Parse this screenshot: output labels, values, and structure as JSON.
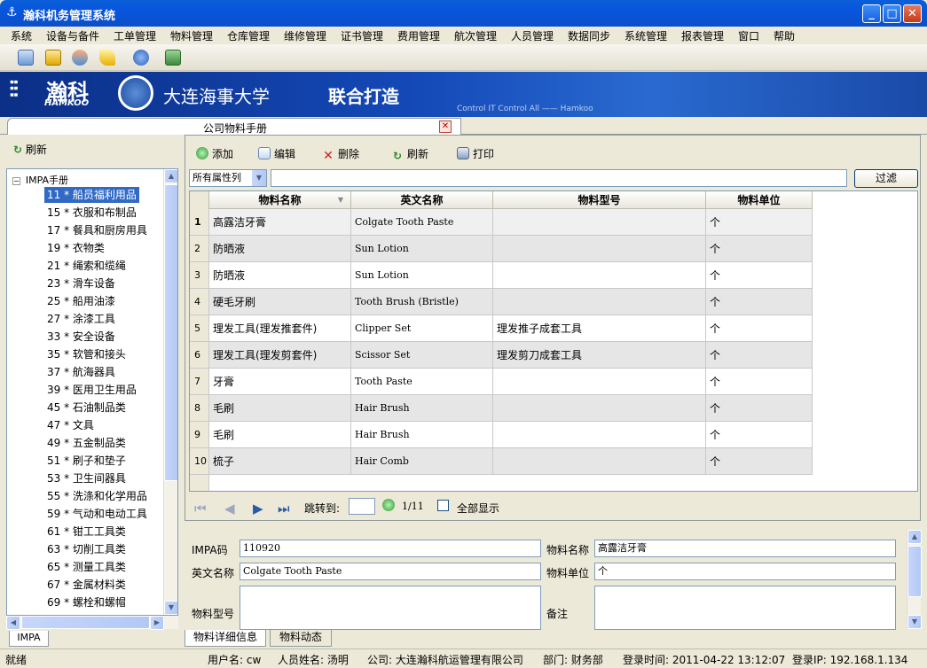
{
  "window": {
    "title": "瀚科机务管理系统",
    "btn_min": "_",
    "btn_max": "□",
    "btn_close": "✕"
  },
  "menu": [
    "系统",
    "设备与备件",
    "工单管理",
    "物料管理",
    "仓库管理",
    "维修管理",
    "证书管理",
    "费用管理",
    "航次管理",
    "人员管理",
    "数据同步",
    "系统管理",
    "报表管理",
    "窗口",
    "帮助"
  ],
  "banner": {
    "logo_cn": "瀚科",
    "logo_en": "HAMKOO",
    "university": "大连海事大学",
    "slogan": "联合打造",
    "tagline": "Control IT Control All —— Hamkoo"
  },
  "doc_tab": {
    "title": "公司物料手册",
    "close": "✕"
  },
  "left": {
    "refresh": "刷新",
    "tree_root": "IMPA手册",
    "tree_items": [
      "11 * 船员福利用品",
      "15 * 衣服和布制品",
      "17 * 餐具和厨房用具",
      "19 * 衣物类",
      "21 * 绳索和缆绳",
      "23 * 滑车设备",
      "25 * 船用油漆",
      "27 * 涂漆工具",
      "33 * 安全设备",
      "35 * 软管和接头",
      "37 * 航海器具",
      "39 * 医用卫生用品",
      "45 * 石油制品类",
      "47 * 文具",
      "49 * 五金制品类",
      "51 * 刷子和垫子",
      "53 * 卫生间器具",
      "55 * 洗涤和化学用品",
      "59 * 气动和电动工具",
      "61 * 钳工工具类",
      "63 * 切削工具类",
      "65 * 测量工具类",
      "67 * 金属材料类",
      "69 * 螺栓和螺帽"
    ],
    "tab_label": "IMPA"
  },
  "toolbar": {
    "add": "添加",
    "edit": "编辑",
    "delete": "删除",
    "refresh": "刷新",
    "print": "打印"
  },
  "filter": {
    "select_value": "所有属性列",
    "input_value": "",
    "button": "过滤"
  },
  "grid": {
    "columns": [
      "物料名称",
      "英文名称",
      "物料型号",
      "物料单位"
    ],
    "rows": [
      {
        "no": "1",
        "name": "高露洁牙膏",
        "en": "Colgate Tooth Paste",
        "model": "",
        "unit": "个"
      },
      {
        "no": "2",
        "name": "防晒液",
        "en": "Sun Lotion",
        "model": "",
        "unit": "个"
      },
      {
        "no": "3",
        "name": "防晒液",
        "en": "Sun Lotion",
        "model": "",
        "unit": "个"
      },
      {
        "no": "4",
        "name": "硬毛牙刷",
        "en": "Tooth Brush (Bristle)",
        "model": "",
        "unit": "个"
      },
      {
        "no": "5",
        "name": "理发工具(理发推套件)",
        "en": "Clipper Set",
        "model": "理发推子成套工具",
        "unit": "个"
      },
      {
        "no": "6",
        "name": "理发工具(理发剪套件)",
        "en": "Scissor Set",
        "model": "理发剪刀成套工具",
        "unit": "个"
      },
      {
        "no": "7",
        "name": "牙膏",
        "en": "Tooth Paste",
        "model": "",
        "unit": "个"
      },
      {
        "no": "8",
        "name": "毛刷",
        "en": "Hair Brush",
        "model": "",
        "unit": "个"
      },
      {
        "no": "9",
        "name": "毛刷",
        "en": "Hair Brush",
        "model": "",
        "unit": "个"
      },
      {
        "no": "10",
        "name": "梳子",
        "en": "Hair Comb",
        "model": "",
        "unit": "个"
      }
    ]
  },
  "pager": {
    "jump_label": "跳转到:",
    "jump_value": "",
    "page_info": "1/11",
    "show_all": "全部显示"
  },
  "detail": {
    "impa_label": "IMPA码",
    "impa_value": "110920",
    "name_label": "物料名称",
    "name_value": "高露洁牙膏",
    "en_label": "英文名称",
    "en_value": "Colgate Tooth Paste",
    "unit_label": "物料单位",
    "unit_value": "个",
    "model_label": "物料型号",
    "model_value": "",
    "remark_label": "备注",
    "remark_value": ""
  },
  "bottom_tabs": [
    "物料详细信息",
    "物料动态"
  ],
  "status": {
    "ready": "就绪",
    "user": "用户名: cw",
    "person": "人员姓名: 汤明",
    "company": "公司: 大连瀚科航运管理有限公司",
    "dept": "部门: 财务部",
    "login_time": "登录时间: 2011-04-22 13:12:07",
    "login_ip": "登录IP: 192.168.1.134"
  }
}
